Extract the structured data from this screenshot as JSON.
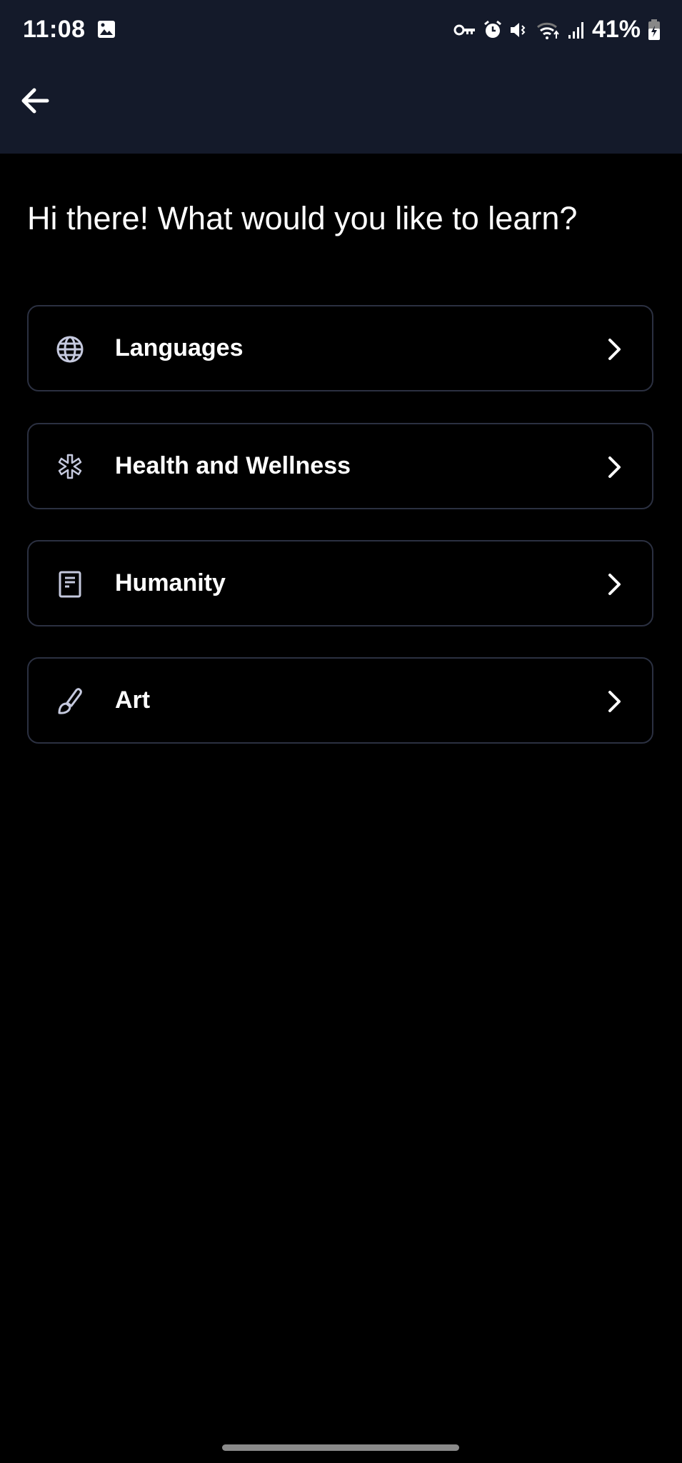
{
  "status_bar": {
    "time": "11:08",
    "battery": "41%",
    "icons": [
      "gallery-icon",
      "vpn-key-icon",
      "alarm-icon",
      "mute-icon",
      "wifi-icon",
      "signal-icon",
      "battery-charging-icon"
    ]
  },
  "header": {
    "back_icon": "arrow-left-icon"
  },
  "main": {
    "title": "Hi there! What would you like to learn?",
    "categories": [
      {
        "label": "Languages",
        "icon": "globe-icon"
      },
      {
        "label": "Health and Wellness",
        "icon": "asterisk-icon"
      },
      {
        "label": "Humanity",
        "icon": "document-icon"
      },
      {
        "label": "Art",
        "icon": "paintbrush-icon"
      }
    ]
  },
  "colors": {
    "header_bg": "#141a2a",
    "background": "#000000",
    "card_border": "#2b3041",
    "icon": "#c5c9de"
  }
}
